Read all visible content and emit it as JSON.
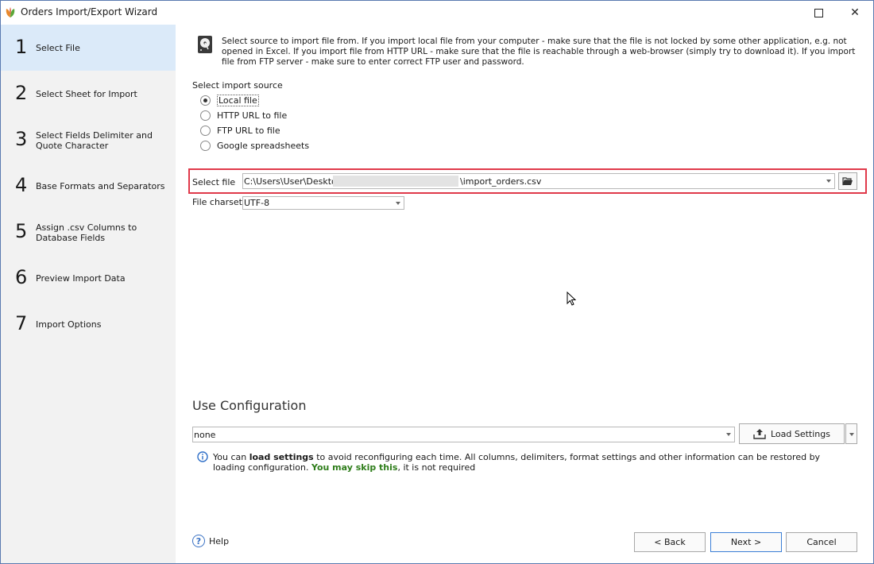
{
  "window": {
    "title": "Orders Import/Export Wizard",
    "close_glyph": "✕"
  },
  "steps": [
    {
      "num": "1",
      "label": "Select File",
      "active": true
    },
    {
      "num": "2",
      "label": "Select Sheet for Import"
    },
    {
      "num": "3",
      "label": "Select Fields Delimiter and Quote Character"
    },
    {
      "num": "4",
      "label": "Base Formats and Separators"
    },
    {
      "num": "5",
      "label": "Assign .csv Columns to Database Fields"
    },
    {
      "num": "6",
      "label": "Preview Import Data"
    },
    {
      "num": "7",
      "label": "Import Options"
    }
  ],
  "intro": {
    "text": "Select source to import file from. If you import local file from your computer - make sure that the file is not locked by some other application, e.g. not opened in Excel. If you import file from HTTP URL - make sure that the file is reachable through a web-browser (simply try to download it). If you import file from FTP server - make sure to enter correct FTP user and password."
  },
  "import_source": {
    "label": "Select import source",
    "options": [
      {
        "label": "Local file",
        "checked": true
      },
      {
        "label": "HTTP URL to file"
      },
      {
        "label": "FTP URL to file"
      },
      {
        "label": "Google spreadsheets"
      }
    ]
  },
  "file": {
    "label": "Select file",
    "path_prefix": "C:\\Users\\User\\Desktop",
    "path_suffix": "\\import_orders.csv"
  },
  "charset": {
    "label": "File charset",
    "value": "UTF-8"
  },
  "configuration": {
    "title": "Use Configuration",
    "value": "none",
    "load_button": "Load Settings",
    "note_prefix": "You can ",
    "note_bold": "load settings",
    "note_middle": " to avoid reconfiguring each time. All columns, delimiters, format settings and other information can be restored by loading configuration. ",
    "note_green": "You may skip this",
    "note_suffix": ", it is not required"
  },
  "footer": {
    "help": "Help",
    "back": "< Back",
    "next": "Next >",
    "cancel": "Cancel"
  },
  "colors": {
    "accent": "#3c7fd6",
    "highlight": "#e0394a",
    "active_step": "#dbeaf9",
    "green_text": "#2e7d1a"
  }
}
